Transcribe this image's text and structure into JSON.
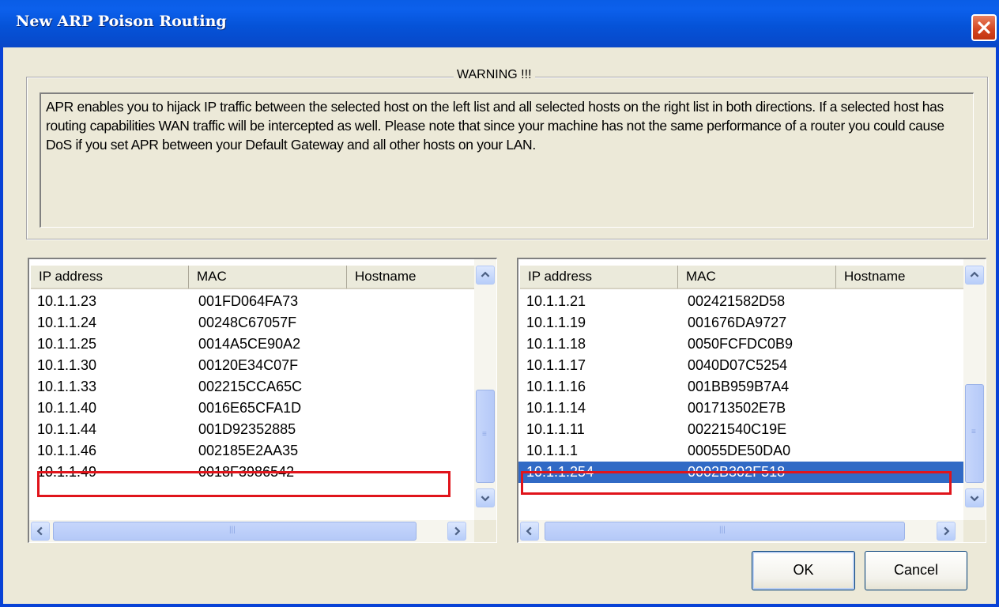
{
  "window": {
    "title": "New ARP Poison Routing"
  },
  "warning": {
    "legend": "WARNING !!!",
    "text": "APR enables you to hijack IP traffic between the selected host on the left list and all selected hosts on the right list in both directions. If a selected host has routing capabilities WAN traffic will be intercepted as well. Please note that since your machine has not the same performance of a router you could cause DoS if you set APR between your Default Gateway and all other hosts on your LAN."
  },
  "left_list": {
    "columns": [
      "IP address",
      "MAC",
      "Hostname"
    ],
    "rows": [
      {
        "ip": "10.1.1.23",
        "mac": "001FD064FA73",
        "host": ""
      },
      {
        "ip": "10.1.1.24",
        "mac": "00248C67057F",
        "host": ""
      },
      {
        "ip": "10.1.1.25",
        "mac": "0014A5CE90A2",
        "host": ""
      },
      {
        "ip": "10.1.1.30",
        "mac": "00120E34C07F",
        "host": ""
      },
      {
        "ip": "10.1.1.33",
        "mac": "002215CCA65C",
        "host": ""
      },
      {
        "ip": "10.1.1.40",
        "mac": "0016E65CFA1D",
        "host": ""
      },
      {
        "ip": "10.1.1.44",
        "mac": "001D92352885",
        "host": ""
      },
      {
        "ip": "10.1.1.46",
        "mac": "002185E2AA35",
        "host": ""
      },
      {
        "ip": "10.1.1.49",
        "mac": "0018F3986542",
        "host": ""
      }
    ],
    "selected_row": 8
  },
  "right_list": {
    "columns": [
      "IP address",
      "MAC",
      "Hostname"
    ],
    "rows": [
      {
        "ip": "10.1.1.21",
        "mac": "002421582D58",
        "host": ""
      },
      {
        "ip": "10.1.1.19",
        "mac": "001676DA9727",
        "host": ""
      },
      {
        "ip": "10.1.1.18",
        "mac": "0050FCFDC0B9",
        "host": ""
      },
      {
        "ip": "10.1.1.17",
        "mac": "0040D07C5254",
        "host": ""
      },
      {
        "ip": "10.1.1.16",
        "mac": "001BB959B7A4",
        "host": ""
      },
      {
        "ip": "10.1.1.14",
        "mac": "001713502E7B",
        "host": ""
      },
      {
        "ip": "10.1.1.11",
        "mac": "00221540C19E",
        "host": ""
      },
      {
        "ip": "10.1.1.1",
        "mac": "00055DE50DA0",
        "host": ""
      },
      {
        "ip": "10.1.1.254",
        "mac": "0002B302F518",
        "host": ""
      }
    ],
    "selected_row": 8
  },
  "buttons": {
    "ok": "OK",
    "cancel": "Cancel"
  },
  "icons": {
    "close": "close-icon",
    "scroll_up": "chevron-up-icon",
    "scroll_down": "chevron-down-icon",
    "scroll_left": "chevron-left-icon",
    "scroll_right": "chevron-right-icon"
  },
  "colors": {
    "selection": "#316ac5",
    "highlight_border": "#e0141b",
    "titlebar": "#0553d8",
    "close": "#d3441f"
  }
}
